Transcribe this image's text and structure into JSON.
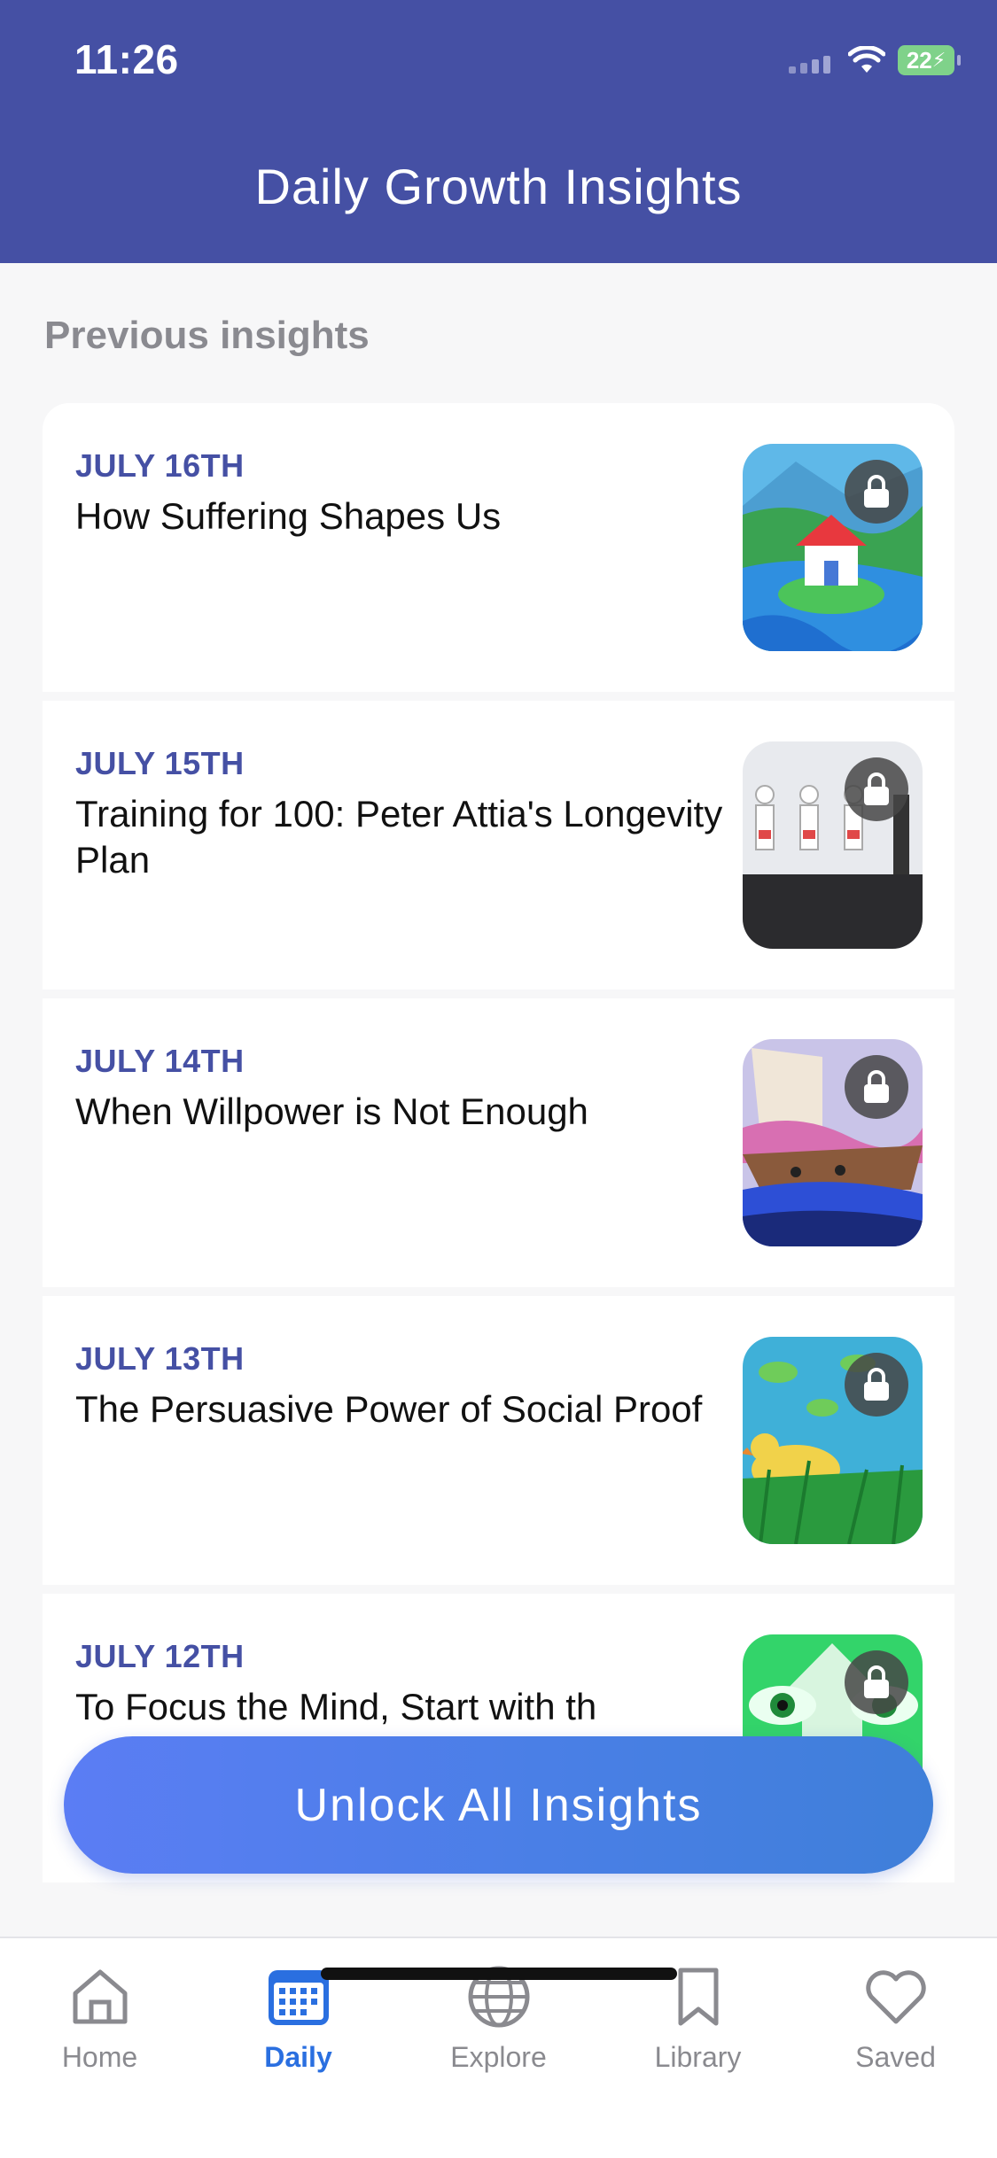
{
  "status_bar": {
    "time": "11:26",
    "battery": "22"
  },
  "header": {
    "title": "Daily Growth Insights"
  },
  "section_label": "Previous insights",
  "cards": [
    {
      "date": "JULY 16TH",
      "title": "How Suffering Shapes Us",
      "thumbnail": "house-on-island-illustration",
      "locked": true
    },
    {
      "date": "JULY 15TH",
      "title": "Training for 100: Peter Attia's Longevity Plan",
      "thumbnail": "figures-exercising-illustration",
      "locked": true
    },
    {
      "date": "JULY 14TH",
      "title": "When Willpower is Not Enough",
      "thumbnail": "boat-at-sea-illustration",
      "locked": true
    },
    {
      "date": "JULY 13TH",
      "title": "The Persuasive Power of Social Proof",
      "thumbnail": "ducks-in-pond-illustration",
      "locked": true
    },
    {
      "date": "JULY 12TH",
      "title": "To Focus the Mind, Start with th",
      "thumbnail": "eyes-and-arrow-illustration",
      "locked": true
    }
  ],
  "unlock_button": "Unlock All Insights",
  "nav": {
    "items": [
      {
        "label": "Home",
        "icon": "home-icon"
      },
      {
        "label": "Daily",
        "icon": "calendar-icon"
      },
      {
        "label": "Explore",
        "icon": "globe-icon"
      },
      {
        "label": "Library",
        "icon": "bookmark-icon"
      },
      {
        "label": "Saved",
        "icon": "heart-icon"
      }
    ],
    "active": "Daily"
  },
  "colors": {
    "header": "#4550a4",
    "accent": "#2a6fe0",
    "date": "#4550a4"
  }
}
